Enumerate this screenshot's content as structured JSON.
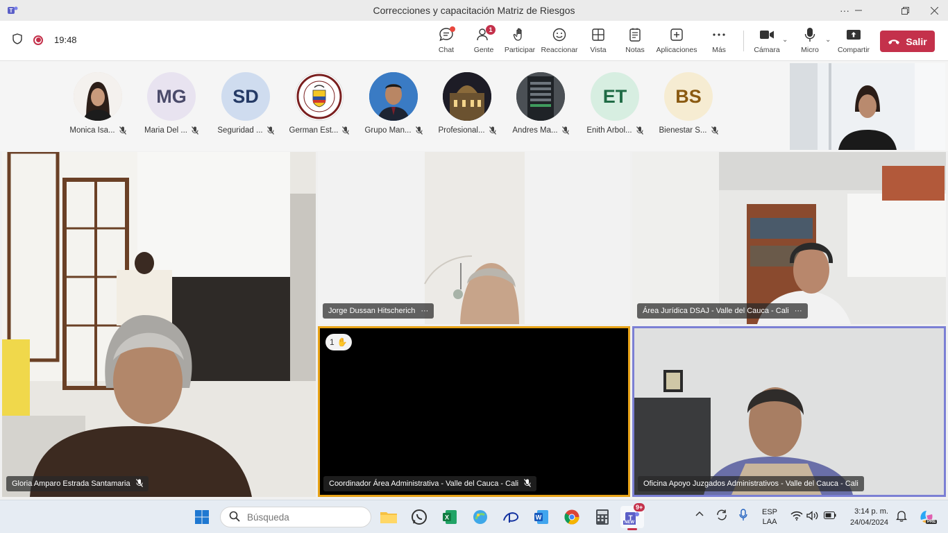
{
  "window": {
    "title": "Correcciones y capacitación Matriz de Riesgos"
  },
  "toolbar": {
    "timer": "19:48",
    "chat_label": "Chat",
    "people_label": "Gente",
    "people_badge": "1",
    "raise_label": "Participar",
    "react_label": "Reaccionar",
    "view_label": "Vista",
    "notes_label": "Notas",
    "apps_label": "Aplicaciones",
    "more_label": "Más",
    "camera_label": "Cámara",
    "mic_label": "Micro",
    "share_label": "Compartir",
    "leave_label": "Salir",
    "leave_color": "#c4314b"
  },
  "participants": [
    {
      "name": "Monica Isa...",
      "initials": "",
      "photo": true
    },
    {
      "name": "Maria Del ...",
      "initials": "MG",
      "bg": "#e8e3f0",
      "fg": "#4a4a6a"
    },
    {
      "name": "Seguridad ...",
      "initials": "SD",
      "bg": "#cfdcef",
      "fg": "#243a66"
    },
    {
      "name": "German Est...",
      "initials": "",
      "photo": true
    },
    {
      "name": "Grupo Man...",
      "initials": "",
      "photo": true
    },
    {
      "name": "Profesional...",
      "initials": "",
      "photo": true
    },
    {
      "name": "Andres Ma...",
      "initials": "",
      "photo": true
    },
    {
      "name": "Enith Arbol...",
      "initials": "ET",
      "bg": "#d7eee1",
      "fg": "#1f6b45"
    },
    {
      "name": "Bienestar S...",
      "initials": "BS",
      "bg": "#f6ecd2",
      "fg": "#8a5a11"
    }
  ],
  "videos": {
    "gloria": "Gloria Amparo Estrada Santamaria",
    "jorge": "Jorge Dussan Hitscherich",
    "area_juridica": "Área Jurídica DSAJ - Valle del Cauca - Cali",
    "coordinador": "Coordinador Área Administrativa - Valle del Cauca - Cali",
    "oficina": "Oficina Apoyo Juzgados Administrativos - Valle del Cauca - Cali",
    "raised_hand_count": "1"
  },
  "taskbar": {
    "search_placeholder": "Búsqueda",
    "teams_badge": "9+",
    "teams_new_label": "NEW",
    "lang_top": "ESP",
    "lang_bottom": "LAA",
    "time": "3:14 p. m.",
    "date": "24/04/2024",
    "copilot_label": "PRE"
  }
}
